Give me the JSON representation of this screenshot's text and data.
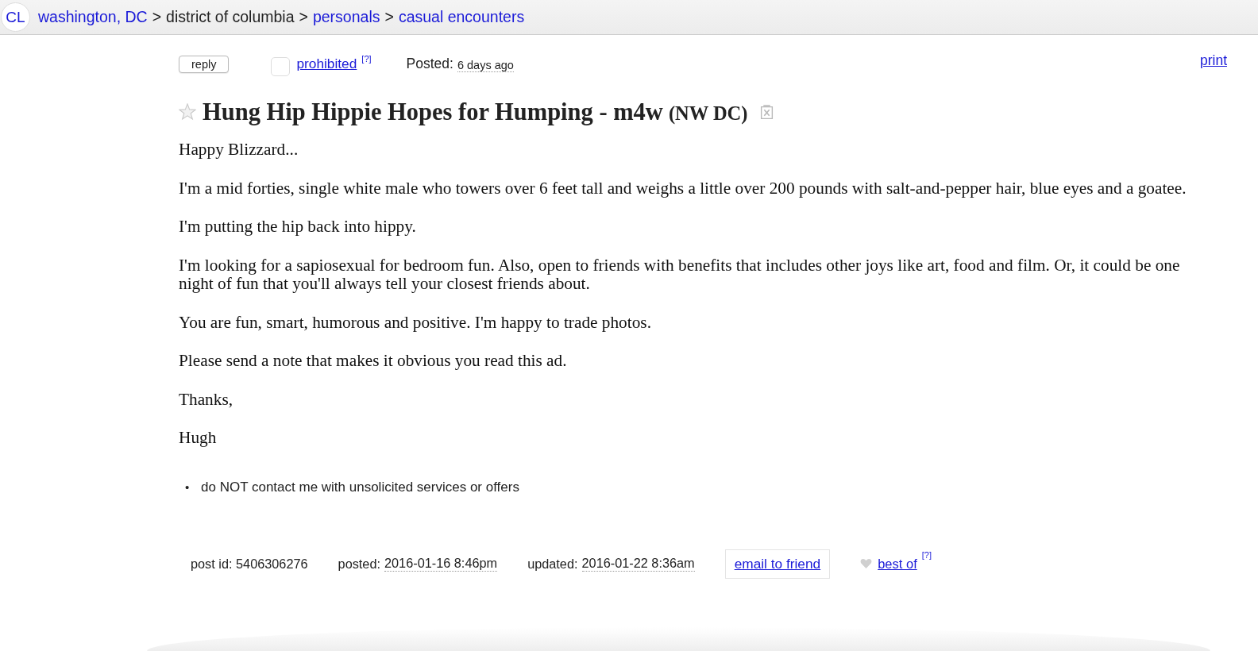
{
  "header": {
    "logo": "CL",
    "breadcrumbs": [
      {
        "label": "washington, DC",
        "kind": "link"
      },
      {
        "label": ">",
        "kind": "separator"
      },
      {
        "label": "district of columbia",
        "kind": "plain"
      },
      {
        "label": ">",
        "kind": "separator"
      },
      {
        "label": "personals",
        "kind": "link"
      },
      {
        "label": ">",
        "kind": "separator"
      },
      {
        "label": "casual encounters",
        "kind": "link"
      }
    ]
  },
  "toolbar": {
    "reply_button": "reply",
    "flag": {
      "checked": false,
      "label": "prohibited",
      "help": "[?]"
    },
    "posted": {
      "label": "Posted:",
      "value": "6 days ago"
    },
    "print_link": "print"
  },
  "title": {
    "favorite": false,
    "text": "Hung Hip Hippie Hopes for Humping - m4w",
    "location": "(NW DC)"
  },
  "body": [
    "Happy Blizzard...",
    "I'm a mid forties, single white male who towers over 6 feet tall and weighs a little over 200 pounds with salt-and-pepper hair, blue eyes and a goatee.",
    "I'm putting the hip back into hippy.",
    "I'm looking for a sapiosexual for bedroom fun. Also, open to friends with benefits that includes other joys like art, food and film. Or, it could be one night of fun that you'll always tell your closest friends about.",
    "You are fun, smart, humorous and positive. I'm happy to trade photos.",
    "Please send a note that makes it obvious you read this ad.",
    "Thanks,",
    "Hugh"
  ],
  "notices": [
    {
      "marker": "•",
      "text": "do NOT contact me with unsolicited services or offers"
    }
  ],
  "footer": {
    "post_id": {
      "label": "post id:",
      "value": "5406306276"
    },
    "posted": {
      "label": "posted:",
      "value": "2016-01-16 8:46pm"
    },
    "updated": {
      "label": "updated:",
      "value": "2016-01-22 8:36am"
    },
    "email_button": "email to friend",
    "best_of": {
      "nominated": false,
      "label": "best of",
      "help": "[?]"
    }
  }
}
